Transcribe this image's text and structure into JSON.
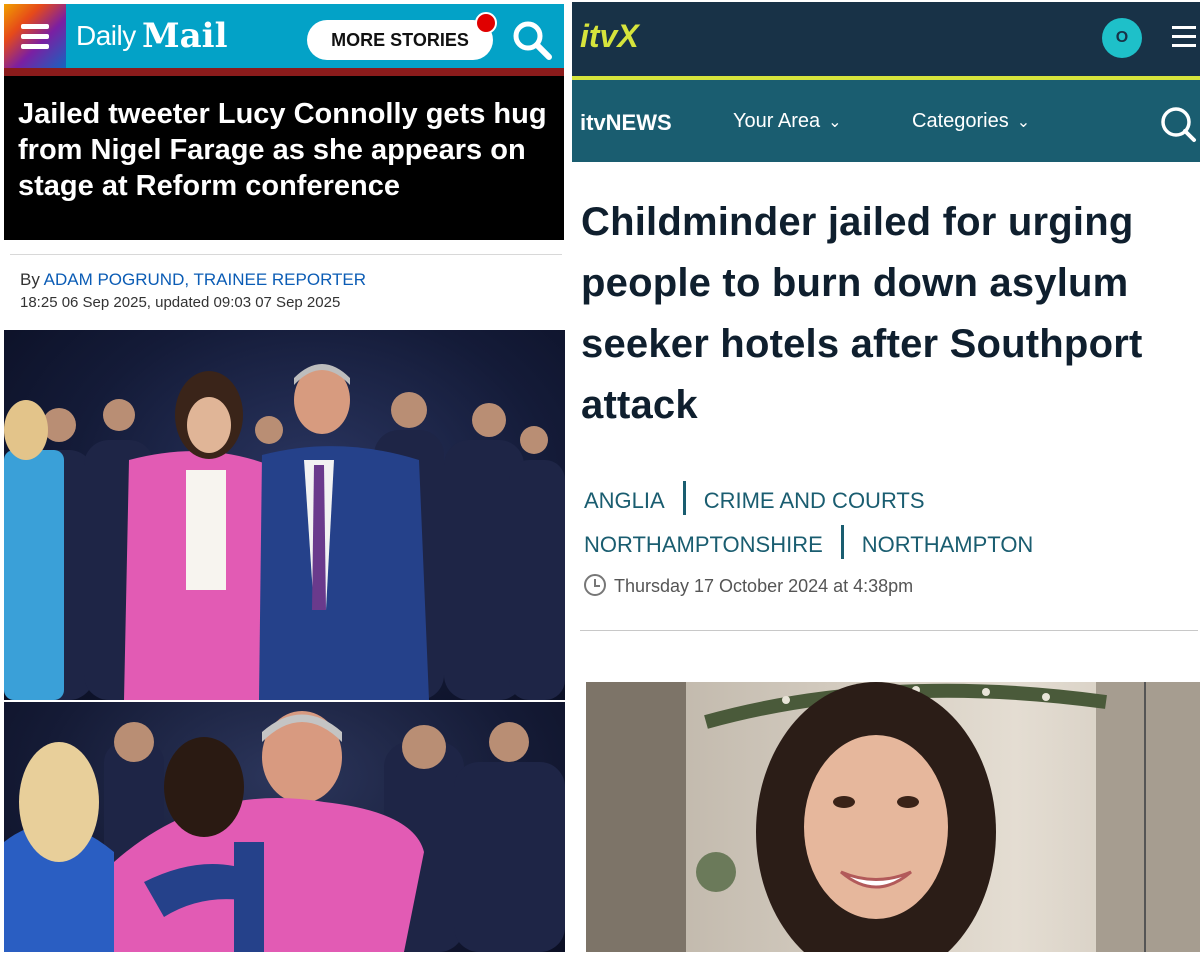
{
  "daily_mail": {
    "logo_light": "Daily",
    "logo_bold": "Mail",
    "more_stories": "MORE STORIES",
    "headline": "Jailed tweeter Lucy Connolly gets hug from Nigel Farage as she appears on stage at Reform conference",
    "byline_prefix": "By ",
    "author": "ADAM POGRUND, TRAINEE REPORTER",
    "date": "18:25 06 Sep 2025, updated 09:03 07 Sep 2025",
    "colors": {
      "header": "#03a2c7",
      "headline_bg": "#000000",
      "author_link": "#0b5cb5",
      "notification_dot": "#e00000"
    }
  },
  "itv": {
    "logo": "itvX",
    "avatar_letter": "O",
    "news_label": "itvNEWS",
    "nav": [
      {
        "label": "Your Area"
      },
      {
        "label": "Categories"
      }
    ],
    "headline": "Childminder jailed for urging people to burn down asylum seeker hotels after Southport attack",
    "tags_row1": [
      "ANGLIA",
      "CRIME AND COURTS"
    ],
    "tags_row2": [
      "NORTHAMPTONSHIRE",
      "NORTHAMPTON"
    ],
    "timestamp": "Thursday 17 October 2024 at 4:38pm",
    "colors": {
      "top_bar": "#183247",
      "nav_bar": "#1a5d70",
      "accent": "#d6e43c",
      "avatar": "#1ec0c9"
    }
  }
}
